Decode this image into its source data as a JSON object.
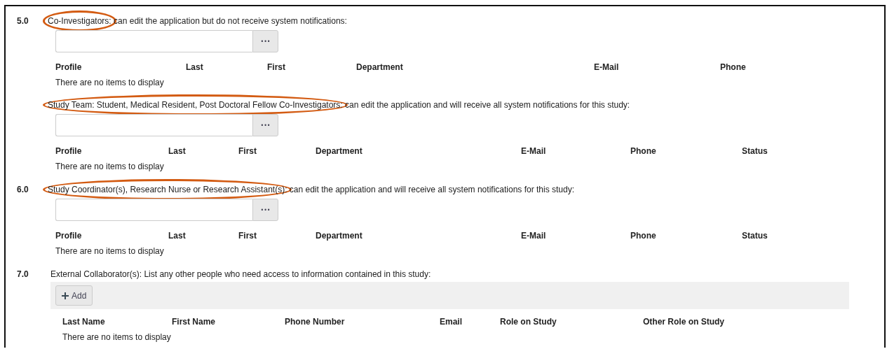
{
  "sections": [
    {
      "number": "5.0",
      "blocks": [
        {
          "kind": "picker",
          "label": [
            {
              "text": "Co-Investigators:",
              "circled": true
            },
            {
              "text": "can edit the application but do not receive system notifications:",
              "circled": false
            }
          ],
          "button": "•••",
          "columns": [
            "Profile",
            "Last",
            "First",
            "Department",
            "E-Mail",
            "Phone"
          ],
          "empty_message": "There are no items to display"
        },
        {
          "kind": "picker",
          "label": [
            {
              "text": "Study Team: Student, Medical Resident, Post Doctoral Fellow Co-Investigators:",
              "circled": true
            },
            {
              "text": "can edit the application and will receive all system notifications for this study:",
              "circled": false
            }
          ],
          "button": "•••",
          "columns": [
            "Profile",
            "Last",
            "First",
            "Department",
            "E-Mail",
            "Phone",
            "Status"
          ],
          "empty_message": "There are no items to display"
        }
      ]
    },
    {
      "number": "6.0",
      "blocks": [
        {
          "kind": "picker",
          "label": [
            {
              "text": "Study Coordinator(s), Research Nurse or Research Assistant(s):",
              "circled": true
            },
            {
              "text": "can edit the application and will receive all system notifications for this study:",
              "circled": false
            }
          ],
          "button": "•••",
          "columns": [
            "Profile",
            "Last",
            "First",
            "Department",
            "E-Mail",
            "Phone",
            "Status"
          ],
          "empty_message": "There are no items to display"
        }
      ]
    },
    {
      "number": "7.0",
      "blocks": [
        {
          "kind": "add",
          "label": [
            {
              "text": "External Collaborator(s): List any other people who need access to information contained in this study:",
              "circled": false
            }
          ],
          "button": "Add",
          "columns": [
            "Last Name",
            "First Name",
            "Phone Number",
            "Email",
            "Role on Study",
            "Other Role on Study"
          ],
          "empty_message": "There are no items to display"
        }
      ]
    }
  ]
}
